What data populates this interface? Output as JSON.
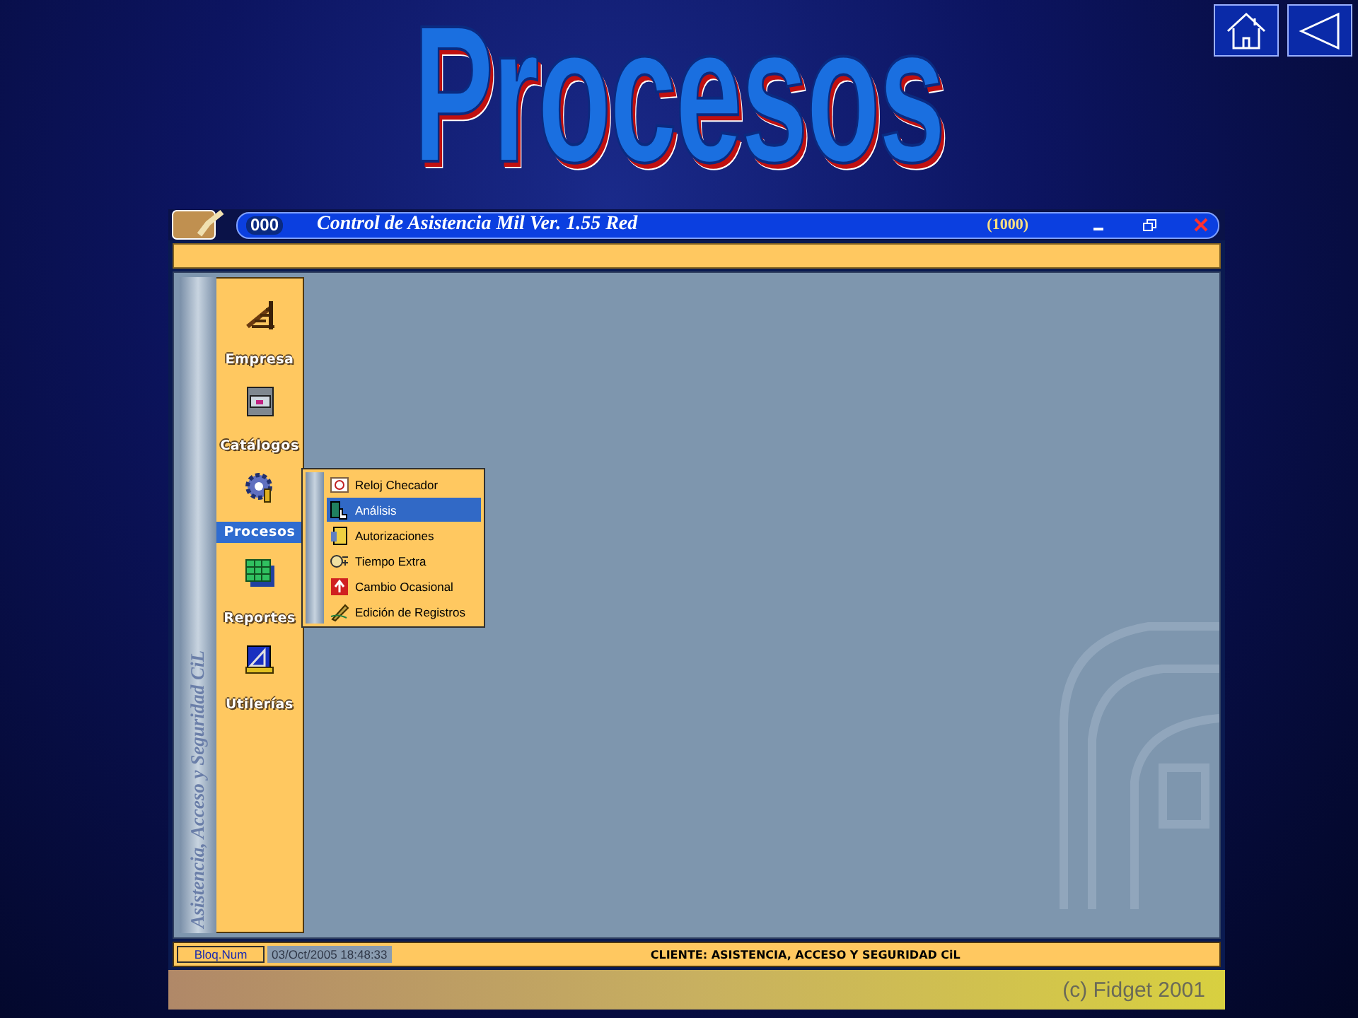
{
  "slide": {
    "title": "Procesos"
  },
  "window": {
    "badge": "000",
    "title": "Control de Asistencia Mil Ver. 1.55 Red",
    "code": "(1000)"
  },
  "sidebar": {
    "caption": "Asistencia, Acceso y Seguridad CiL",
    "items": [
      {
        "label": "Empresa",
        "selected": false
      },
      {
        "label": "Catálogos",
        "selected": false
      },
      {
        "label": "Procesos",
        "selected": true
      },
      {
        "label": "Reportes",
        "selected": false
      },
      {
        "label": "Utilerías",
        "selected": false
      }
    ]
  },
  "menu": {
    "items": [
      {
        "label": "Reloj Checador",
        "selected": false
      },
      {
        "label": "Análisis",
        "selected": true
      },
      {
        "label": "Autorizaciones",
        "selected": false
      },
      {
        "label": "Tiempo Extra",
        "selected": false
      },
      {
        "label": "Cambio Ocasional",
        "selected": false
      },
      {
        "label": "Edición de Registros",
        "selected": false
      }
    ]
  },
  "status_bar": {
    "key": "Bloq.Num",
    "datetime": "03/Oct/2005 18:48:33",
    "client": "CLIENTE:  ASISTENCIA, ACCESO Y SEGURIDAD CiL"
  },
  "footer": {
    "copyright": "(c) Fidget 2001"
  }
}
